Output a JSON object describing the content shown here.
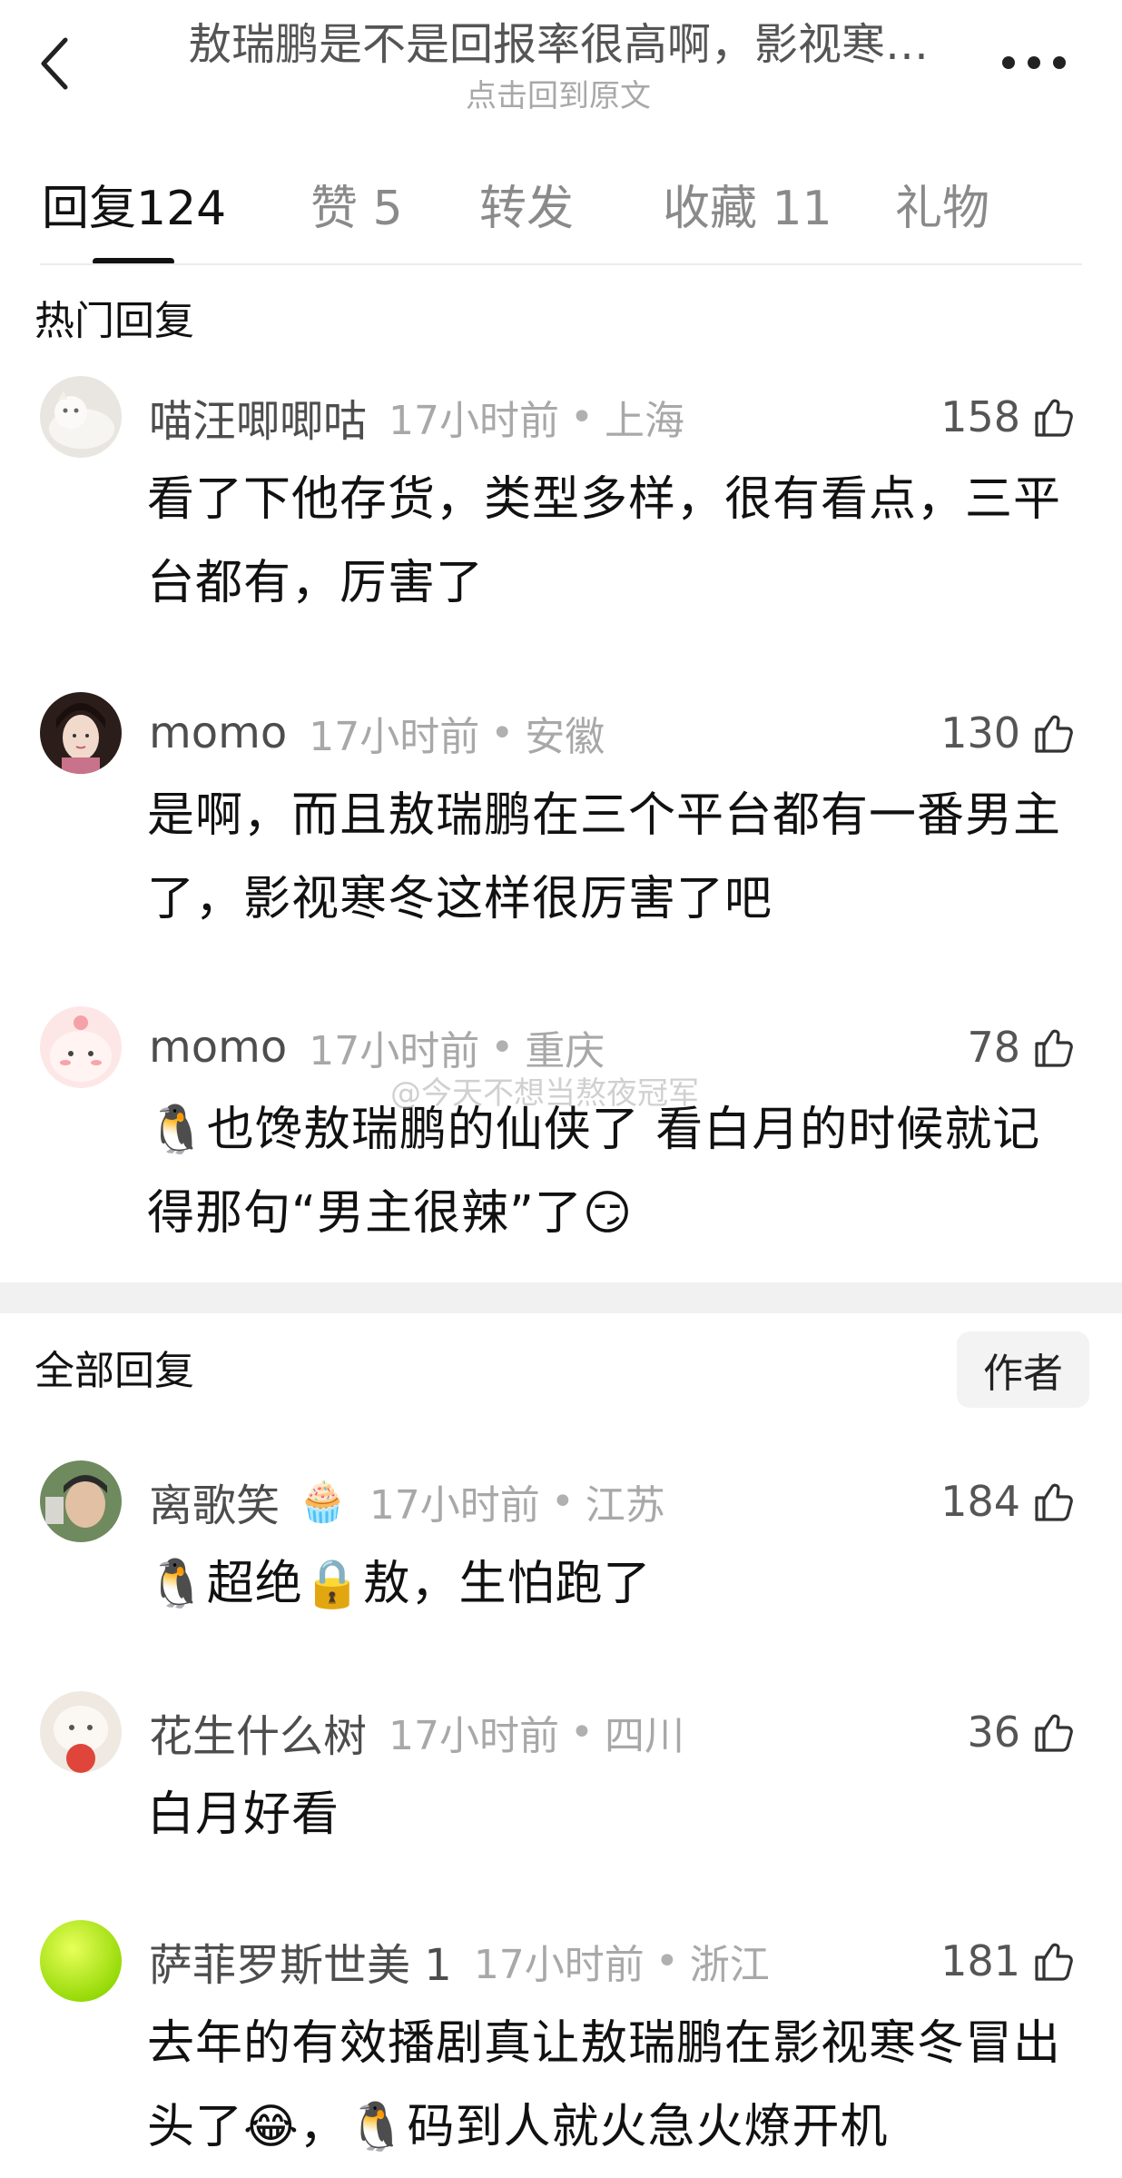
{
  "header": {
    "title": "敖瑞鹏是不是回报率很高啊，影视寒…",
    "subtitle": "点击回到原文"
  },
  "tabs": [
    {
      "label": "回复",
      "count": "124"
    },
    {
      "label": "赞",
      "count": "5"
    },
    {
      "label": "转发",
      "count": ""
    },
    {
      "label": "收藏",
      "count": "11"
    },
    {
      "label": "礼物",
      "count": ""
    }
  ],
  "hot_section": {
    "title": "热门回复"
  },
  "hot_comments": [
    {
      "user": "喵汪唧唧咕",
      "time": "17小时前",
      "location": "上海",
      "likes": "158",
      "text": "看了下他存货，类型多样，很有看点，三平台都有，厉害了"
    },
    {
      "user": "momo",
      "time": "17小时前",
      "location": "安徽",
      "likes": "130",
      "text": "是啊，而且敖瑞鹏在三个平台都有一番男主了，影视寒冬这样很厉害了吧"
    },
    {
      "user": "momo",
      "time": "17小时前",
      "location": "重庆",
      "likes": "78",
      "text": "🐧也馋敖瑞鹏的仙侠了 看白月的时候就记得那句“男主很辣”了😏"
    }
  ],
  "all_section": {
    "title": "全部回复",
    "author_button": "作者"
  },
  "all_comments": [
    {
      "user": "离歌笑",
      "badge": "🧁",
      "time": "17小时前",
      "location": "江苏",
      "likes": "184",
      "text": "🐧超绝🔒敖，生怕跑了"
    },
    {
      "user": "花生什么树",
      "time": "17小时前",
      "location": "四川",
      "likes": "36",
      "text": "白月好看"
    },
    {
      "user": "萨菲罗斯世美 1",
      "time": "17小时前",
      "location": "浙江",
      "likes": "181",
      "text": "去年的有效播剧真让敖瑞鹏在影视寒冬冒出头了😂，🐧码到人就火急火燎开机"
    }
  ],
  "watermark": "@今天不想当熬夜冠军",
  "icons": {
    "back": "chevron-left-icon",
    "more": "more-dots-icon",
    "like": "thumbs-up-icon"
  }
}
